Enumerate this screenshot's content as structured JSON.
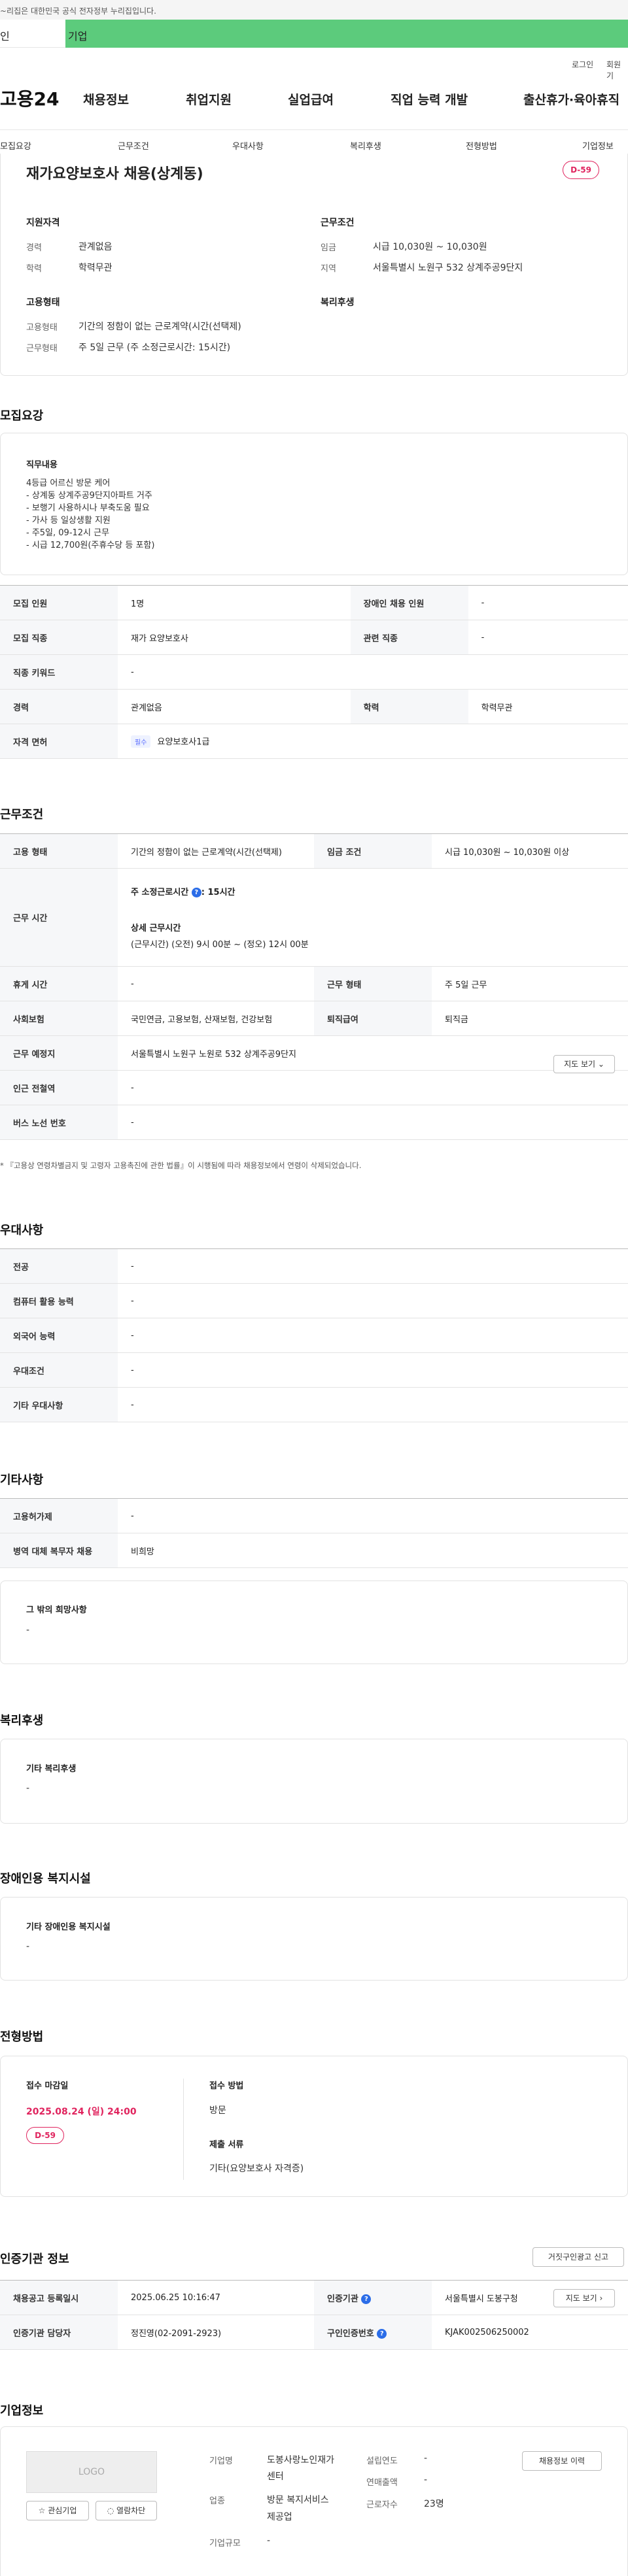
{
  "gov_banner": "~리집은 대한민국 공식 전자정부 누리집입니다.",
  "top_tabs": [
    "인",
    "기업"
  ],
  "util": {
    "login": "로그인",
    "join": "회원기"
  },
  "logo": "고용24",
  "gnb": [
    "채용정보",
    "취업지원",
    "실업급여",
    "직업 능력 개발",
    "출산휴가·육아휴직"
  ],
  "snb": [
    "모집요강",
    "근무조건",
    "우대사항",
    "복리후생",
    "전형방법",
    "기업정보"
  ],
  "job": {
    "title": "재가요양보호사 채용(상계동)",
    "dday": "D-59",
    "qual_title": "지원자격",
    "career_label": "경력",
    "career_value": "관계없음",
    "edu_label": "학력",
    "edu_value": "학력무관",
    "cond_title": "근무조건",
    "wage_label": "임금",
    "wage_value": "시급 10,030원 ~ 10,030원",
    "region_label": "지역",
    "region_value": "서울특별시 노원구 532 상계주공9단지",
    "emp_title": "고용형태",
    "emp_label": "고용형태",
    "emp_value": "기간의 정함이 없는 근로계약(시간(선택제)",
    "work_label": "근무형태",
    "work_value": "주 5일 근무 (주 소정근로시간: 15시간)",
    "welfare_title": "복리후생"
  },
  "recruit": {
    "section": "모집요강",
    "duty_title": "직무내용",
    "duty_lines": [
      "4등급 어르신 방문 케어",
      "- 상계동 상계주공9단지아파트 거주",
      "- 보행기 사용하시나 부축도움 필요",
      "- 가사 등 일상생활 지원",
      "- 주5일, 09-12시 근무",
      "- 시급 12,700원(주휴수당 등 포함)"
    ],
    "rows": [
      {
        "k1": "모집 인원",
        "v1": "1명",
        "k2": "장애인 채용 인원",
        "v2": "-"
      },
      {
        "k1": "모집 직종",
        "v1": "재가 요양보호사",
        "k2": "관련 직종",
        "v2": "-"
      },
      {
        "k1": "직종 키워드",
        "v1": "-"
      },
      {
        "k1": "경력",
        "v1": "관계없음",
        "k2": "학력",
        "v2": "학력무관"
      },
      {
        "k1": "자격 면허",
        "pill": "필수",
        "v1": "요양보호사1급"
      }
    ]
  },
  "conditions": {
    "section": "근무조건",
    "emp_type_k": "고용 형태",
    "emp_type_v": "기간의 정함이 없는 근로계약(시간(선택제)",
    "wage_k": "임금 조건",
    "wage_v": "시급 10,030원 ~ 10,030원 이상",
    "hours_k": "근무 시간",
    "hours_weekly": "주 소정근로시간",
    "hours_weekly_val": ": 15시간",
    "hours_detail_title": "상세 근무시간",
    "hours_detail": "(근무시간) (오전) 9시 00분 ~ (정오) 12시 00분",
    "rest_k": "휴게 시간",
    "rest_v": "-",
    "shape_k": "근무 형태",
    "shape_v": "주 5일 근무",
    "ins_k": "사회보험",
    "ins_v": "국민연금, 고용보험, 산재보험, 건강보험",
    "sev_k": "퇴직급여",
    "sev_v": "퇴직금",
    "place_k": "근무 예정지",
    "place_v": "서울특별시 노원구 노원로 532 상계주공9단지",
    "map_btn": "지도 보기 ⌄",
    "subway_k": "인근 전철역",
    "subway_v": "-",
    "bus_k": "버스 노선 번호",
    "bus_v": "-",
    "note": "* 『고용상 연령차별금지 및 고령자 고용촉진에 관한 법률』이 시행됨에 따라 채용정보에서 연령이 삭제되었습니다."
  },
  "preference": {
    "section": "우대사항",
    "rows": [
      {
        "k": "전공",
        "v": "-"
      },
      {
        "k": "컴퓨터 활용 능력",
        "v": "-"
      },
      {
        "k": "외국어 능력",
        "v": "-"
      },
      {
        "k": "우대조건",
        "v": "-"
      },
      {
        "k": "기타 우대사항",
        "v": "-"
      }
    ]
  },
  "other": {
    "section": "기타사항",
    "rows": [
      {
        "k": "고용허가제",
        "v": "-"
      },
      {
        "k": "병역 대체 복무자 채용",
        "v": "비희망"
      }
    ],
    "box_title": "그 밖의 희망사항",
    "box_value": "-"
  },
  "welfare": {
    "section": "복리후생",
    "box_title": "기타 복리후생",
    "box_value": "-"
  },
  "disabled": {
    "section": "장애인용 복지시설",
    "box_title": "기타 장애인용 복지시설",
    "box_value": "-"
  },
  "selection": {
    "section": "전형방법",
    "deadline_title": "접수 마감일",
    "deadline": "2025.08.24 (일) 24:00",
    "dday": "D-59",
    "method_title": "접수 방법",
    "method": "방문",
    "docs_title": "제출 서류",
    "docs": "기타(요양보호사 자격증)"
  },
  "cert": {
    "section": "인증기관 정보",
    "report_btn": "거짓구인광고 신고",
    "r1k1": "채용공고 등록일시",
    "r1v1": "2025.06.25 10:16:47",
    "r1k2": "인증기관",
    "r1v2": "서울특별시 도봉구청",
    "map_btn": "지도 보기 ›",
    "r2k1": "인증기관 담당자",
    "r2v1": "정진영(02-2091-2923)",
    "r2k2": "구인인증번호",
    "r2v2": "KJAK002506250002"
  },
  "company": {
    "section": "기업정보",
    "logo": "LOGO",
    "fav_btn": "☆ 관심기업",
    "block_btn": "◌ 열람차단",
    "name_k": "기업명",
    "name_v1": "도봉사랑노인재가",
    "name_v2": "센터",
    "ind_k": "업종",
    "ind_v1": "방문 복지서비스",
    "ind_v2": "제공업",
    "size_k": "기업규모",
    "size_v": "-",
    "est_k": "설립연도",
    "est_v": "-",
    "sales_k": "연매출액",
    "sales_v": "-",
    "emp_k": "근로자수",
    "emp_v": "23명",
    "jobs_btn": "채용정보 이력"
  }
}
